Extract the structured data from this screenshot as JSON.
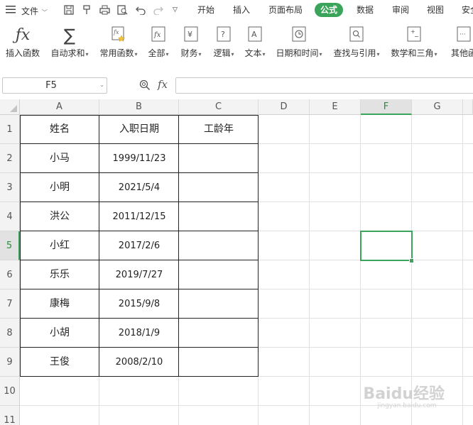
{
  "menubar": {
    "file_label": "文件",
    "tabs": [
      {
        "label": "开始"
      },
      {
        "label": "插入"
      },
      {
        "label": "页面布局"
      },
      {
        "label": "公式"
      },
      {
        "label": "数据"
      },
      {
        "label": "审阅"
      },
      {
        "label": "视图"
      },
      {
        "label": "安全"
      }
    ],
    "active_tab": "公式"
  },
  "ribbon": {
    "insert_function": "插入函数",
    "autosum": "自动求和",
    "common_functions": "常用函数",
    "all": "全部",
    "financial": "财务",
    "logical": "逻辑",
    "text": "文本",
    "datetime": "日期和时间",
    "lookup": "查找与引用",
    "math": "数学和三角",
    "other": "其他函"
  },
  "formulabar": {
    "namebox": "F5",
    "fx_label": "fx",
    "formula": ""
  },
  "columns": [
    "A",
    "B",
    "C",
    "D",
    "E",
    "F",
    "G"
  ],
  "rows": [
    "1",
    "2",
    "3",
    "4",
    "5",
    "6",
    "7",
    "8",
    "9",
    "10",
    "11"
  ],
  "selected_cell": "F5",
  "table": {
    "headers": [
      "姓名",
      "入职日期",
      "工龄年"
    ],
    "rows": [
      [
        "小马",
        "1999/11/23",
        ""
      ],
      [
        "小明",
        "2021/5/4",
        ""
      ],
      [
        "洪公",
        "2011/12/15",
        ""
      ],
      [
        "小红",
        "2017/2/6",
        ""
      ],
      [
        "乐乐",
        "2019/7/27",
        ""
      ],
      [
        "康梅",
        "2015/9/8",
        ""
      ],
      [
        "小胡",
        "2018/1/9",
        ""
      ],
      [
        "王俊",
        "2008/2/10",
        ""
      ]
    ]
  },
  "watermark": {
    "brand": "Baidu经验",
    "url": "jingyan.baidu.com"
  }
}
